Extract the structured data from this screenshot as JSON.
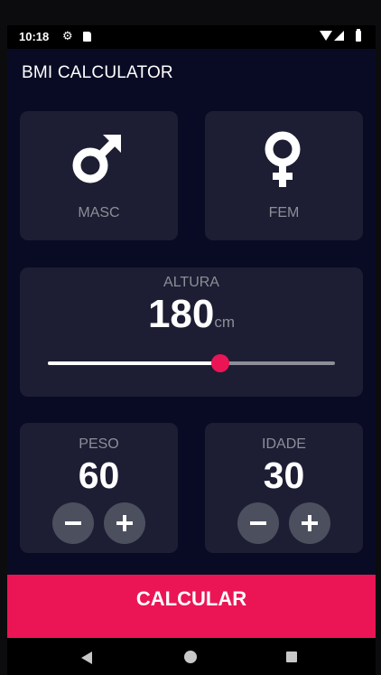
{
  "status_bar": {
    "time": "10:18",
    "icons": [
      "gear-icon",
      "sd-card-icon",
      "wifi-icon",
      "signal-icon",
      "battery-icon"
    ]
  },
  "app_bar": {
    "title": "BMI CALCULATOR"
  },
  "gender": {
    "male": {
      "label": "MASC",
      "icon": "male-icon"
    },
    "female": {
      "label": "FEM",
      "icon": "female-icon"
    }
  },
  "height": {
    "label": "ALTURA",
    "value": "180",
    "unit": "cm",
    "slider_fraction": 0.6
  },
  "weight": {
    "label": "PESO",
    "value": "60",
    "buttons": [
      "minus-icon",
      "plus-icon"
    ]
  },
  "age": {
    "label": "IDADE",
    "value": "30",
    "buttons": [
      "minus-icon",
      "plus-icon"
    ]
  },
  "calculate_button": {
    "label": "CALCULAR"
  },
  "nav_bar": {
    "icons": [
      "back-icon",
      "home-icon",
      "recents-icon"
    ]
  },
  "colors": {
    "background": "#090b24",
    "card": "#1d1e33",
    "accent": "#eb1555",
    "label": "#8d8e98",
    "round_button": "#4c4f5e"
  }
}
